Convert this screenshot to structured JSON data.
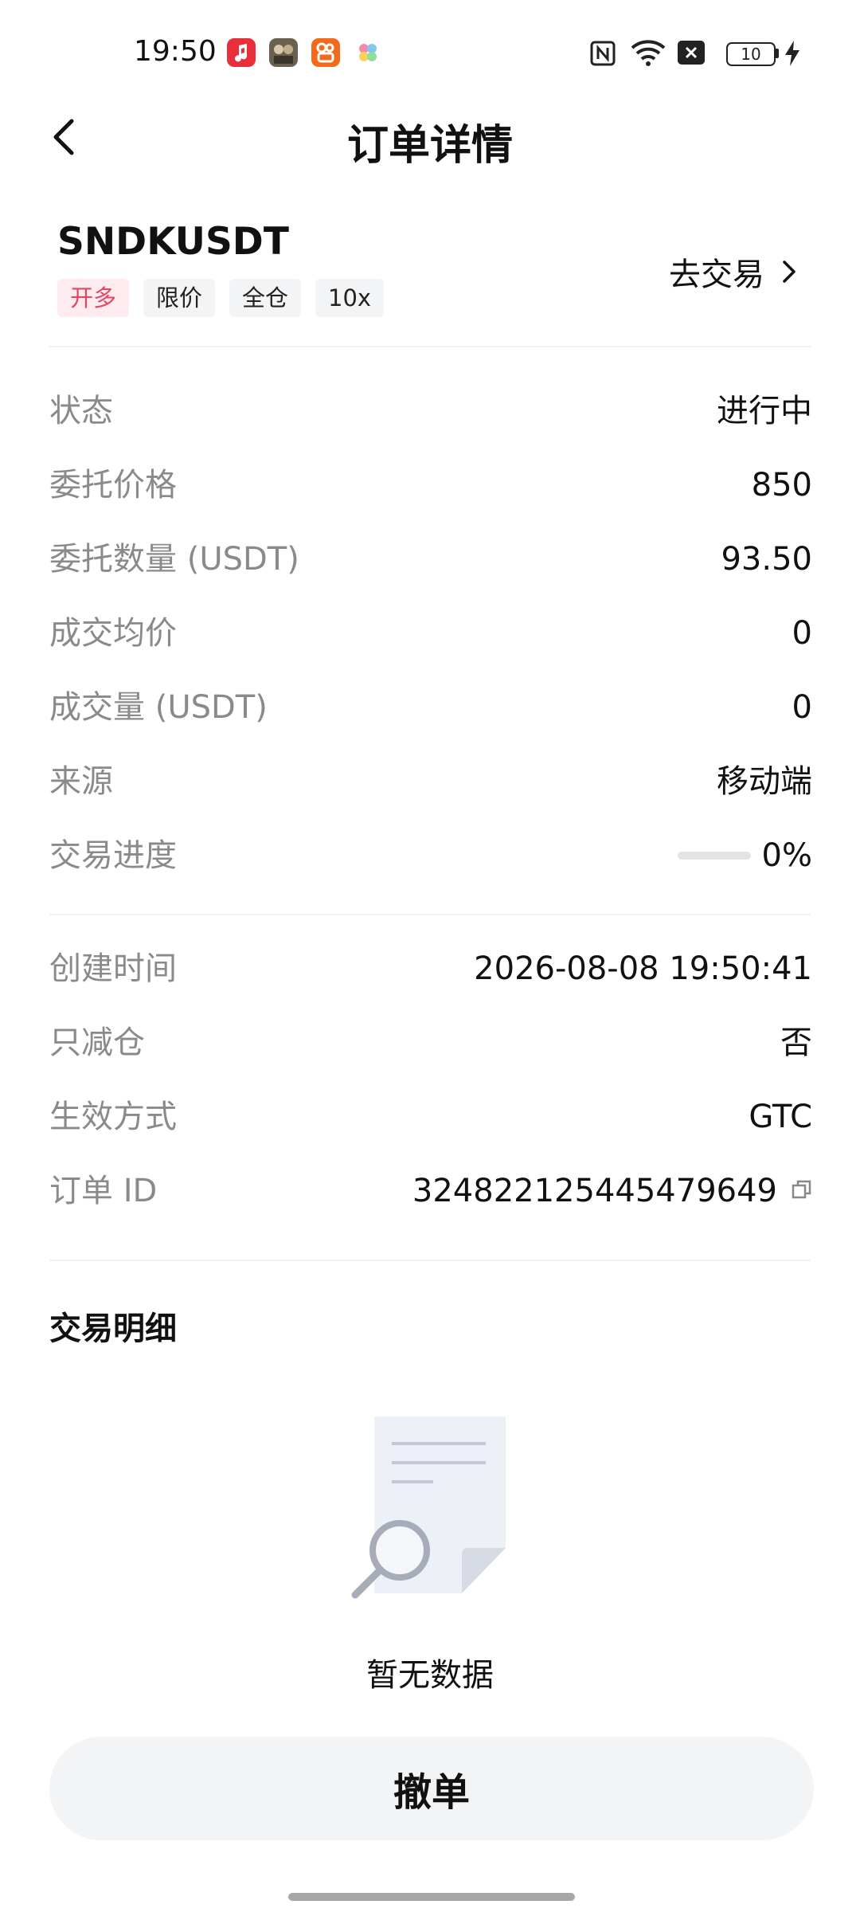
{
  "status_bar": {
    "time": "19:50",
    "battery": "10",
    "icons": [
      "music-app-icon",
      "game-app-icon",
      "kuaishou-app-icon",
      "clover-app-icon",
      "nfc-icon",
      "wifi-icon",
      "no-sim-icon",
      "battery-icon",
      "charging-icon"
    ]
  },
  "header": {
    "title": "订单详情",
    "back_icon": "chevron-left-icon"
  },
  "symbol": {
    "name": "SNDKUSDT",
    "tags": [
      "开多",
      "限价",
      "全仓",
      "10x"
    ],
    "go_trade": "去交易",
    "long_tag_color": "#e24763"
  },
  "details": {
    "status": {
      "label": "状态",
      "value": "进行中"
    },
    "price": {
      "label": "委托价格",
      "value": "850"
    },
    "quantity": {
      "label": "委托数量 (USDT)",
      "value": "93.50"
    },
    "avg_price": {
      "label": "成交均价",
      "value": "0"
    },
    "filled": {
      "label": "成交量 (USDT)",
      "value": "0"
    },
    "source": {
      "label": "来源",
      "value": "移动端"
    },
    "progress": {
      "label": "交易进度",
      "value": "0%",
      "fraction": 0
    }
  },
  "meta": {
    "created": {
      "label": "创建时间",
      "value": "2026-08-08 19:50:41"
    },
    "reduce_only": {
      "label": "只减仓",
      "value": "否"
    },
    "time_in_force": {
      "label": "生效方式",
      "value": "GTC"
    },
    "order_id": {
      "label": "订单 ID",
      "value": "324822125445479649"
    }
  },
  "trades": {
    "title": "交易明细",
    "empty_text": "暂无数据"
  },
  "actions": {
    "cancel": "撤单"
  }
}
